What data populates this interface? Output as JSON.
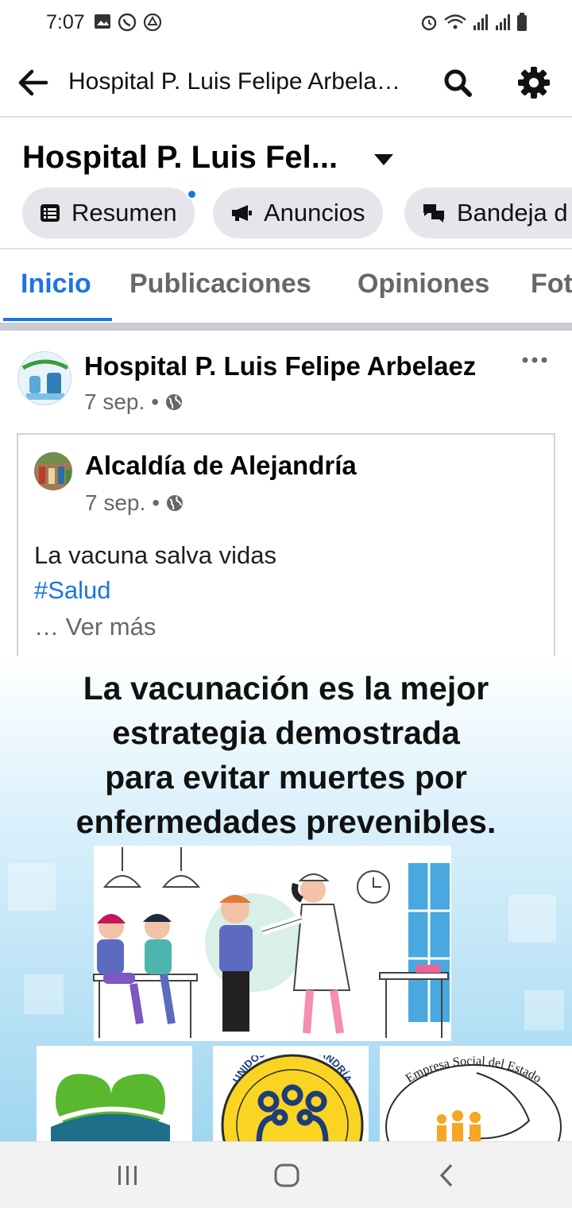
{
  "status_bar": {
    "time": "7:07"
  },
  "app_bar": {
    "title": "Hospital P. Luis Felipe Arbela…"
  },
  "page_header": {
    "name": "Hospital P. Luis Fel...",
    "chips": [
      {
        "label": "Resumen",
        "has_dot": true
      },
      {
        "label": "Anuncios"
      },
      {
        "label": "Bandeja d"
      }
    ]
  },
  "tabs": [
    {
      "label": "Inicio",
      "active": true
    },
    {
      "label": "Publicaciones"
    },
    {
      "label": "Opiniones"
    },
    {
      "label": "Fot"
    }
  ],
  "post": {
    "author": "Hospital P. Luis Felipe Arbelaez",
    "date": "7 sep.",
    "separator": "•",
    "shared": {
      "author": "Alcaldía de Alejandría",
      "date": "7 sep.",
      "separator": "•",
      "text": "La vacuna salva vidas",
      "hashtag": "#Salud",
      "see_more": "… Ver más"
    },
    "image": {
      "headline_lines": [
        "La vacunación es la mejor",
        "estrategia demostrada",
        "para evitar muertes por",
        "enfermedades prevenibles."
      ],
      "logo_center_text": "UNIDOS POR ALEJANDRÍA",
      "logo_right_text": "Empresa Social del Estado"
    }
  },
  "colors": {
    "accent": "#1b74e4",
    "chip_bg": "#e4e6eb",
    "muted": "#65676b"
  }
}
